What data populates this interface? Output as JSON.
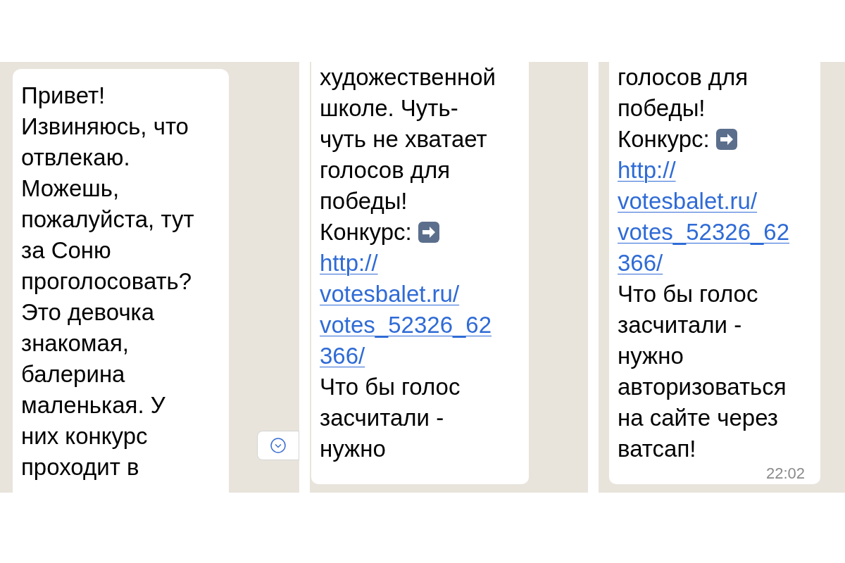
{
  "panels": [
    {
      "lines": [
        {
          "kind": "text",
          "text": "Привет!"
        },
        {
          "kind": "text",
          "text": "Извиняюсь, что"
        },
        {
          "kind": "text",
          "text": "отвлекаю."
        },
        {
          "kind": "text",
          "text": "Можешь,"
        },
        {
          "kind": "text",
          "text": "пожалуйста, тут"
        },
        {
          "kind": "text",
          "text": "за Соню"
        },
        {
          "kind": "text",
          "text": "проголосовать?"
        },
        {
          "kind": "text",
          "text": "Это девочка"
        },
        {
          "kind": "text",
          "text": "знакомая,"
        },
        {
          "kind": "text",
          "text": "балерина"
        },
        {
          "kind": "text",
          "text": "маленькая. У"
        },
        {
          "kind": "text",
          "text": "них конкурс"
        },
        {
          "kind": "text",
          "text": "проходит в"
        }
      ],
      "scroll_button": true
    },
    {
      "lines": [
        {
          "kind": "text",
          "text": "художественной"
        },
        {
          "kind": "text",
          "text": "школе. Чуть-"
        },
        {
          "kind": "text",
          "text": "чуть не хватает"
        },
        {
          "kind": "text",
          "text": "голосов для"
        },
        {
          "kind": "text",
          "text": "победы!"
        },
        {
          "kind": "arrow",
          "text": "Конкурс:"
        },
        {
          "kind": "link",
          "text": "http://"
        },
        {
          "kind": "link",
          "text": "votesbalet.ru/"
        },
        {
          "kind": "link",
          "text": "votes_52326_62"
        },
        {
          "kind": "link",
          "text": "366/"
        },
        {
          "kind": "text",
          "text": "Что бы голос"
        },
        {
          "kind": "text",
          "text": "засчитали -"
        },
        {
          "kind": "text",
          "text": "нужно"
        }
      ]
    },
    {
      "lines": [
        {
          "kind": "text",
          "text": "голосов для"
        },
        {
          "kind": "text",
          "text": "победы!"
        },
        {
          "kind": "arrow",
          "text": "Конкурс:"
        },
        {
          "kind": "link",
          "text": "http://"
        },
        {
          "kind": "link",
          "text": "votesbalet.ru/"
        },
        {
          "kind": "link",
          "text": "votes_52326_62"
        },
        {
          "kind": "link",
          "text": "366/"
        },
        {
          "kind": "text",
          "text": "Что бы голос"
        },
        {
          "kind": "text",
          "text": "засчитали -"
        },
        {
          "kind": "text",
          "text": "нужно"
        },
        {
          "kind": "text",
          "text": "авторизоваться"
        },
        {
          "kind": "text",
          "text": "на сайте через"
        },
        {
          "kind": "text",
          "text": "ватсап!"
        }
      ],
      "time": "22:02"
    }
  ]
}
